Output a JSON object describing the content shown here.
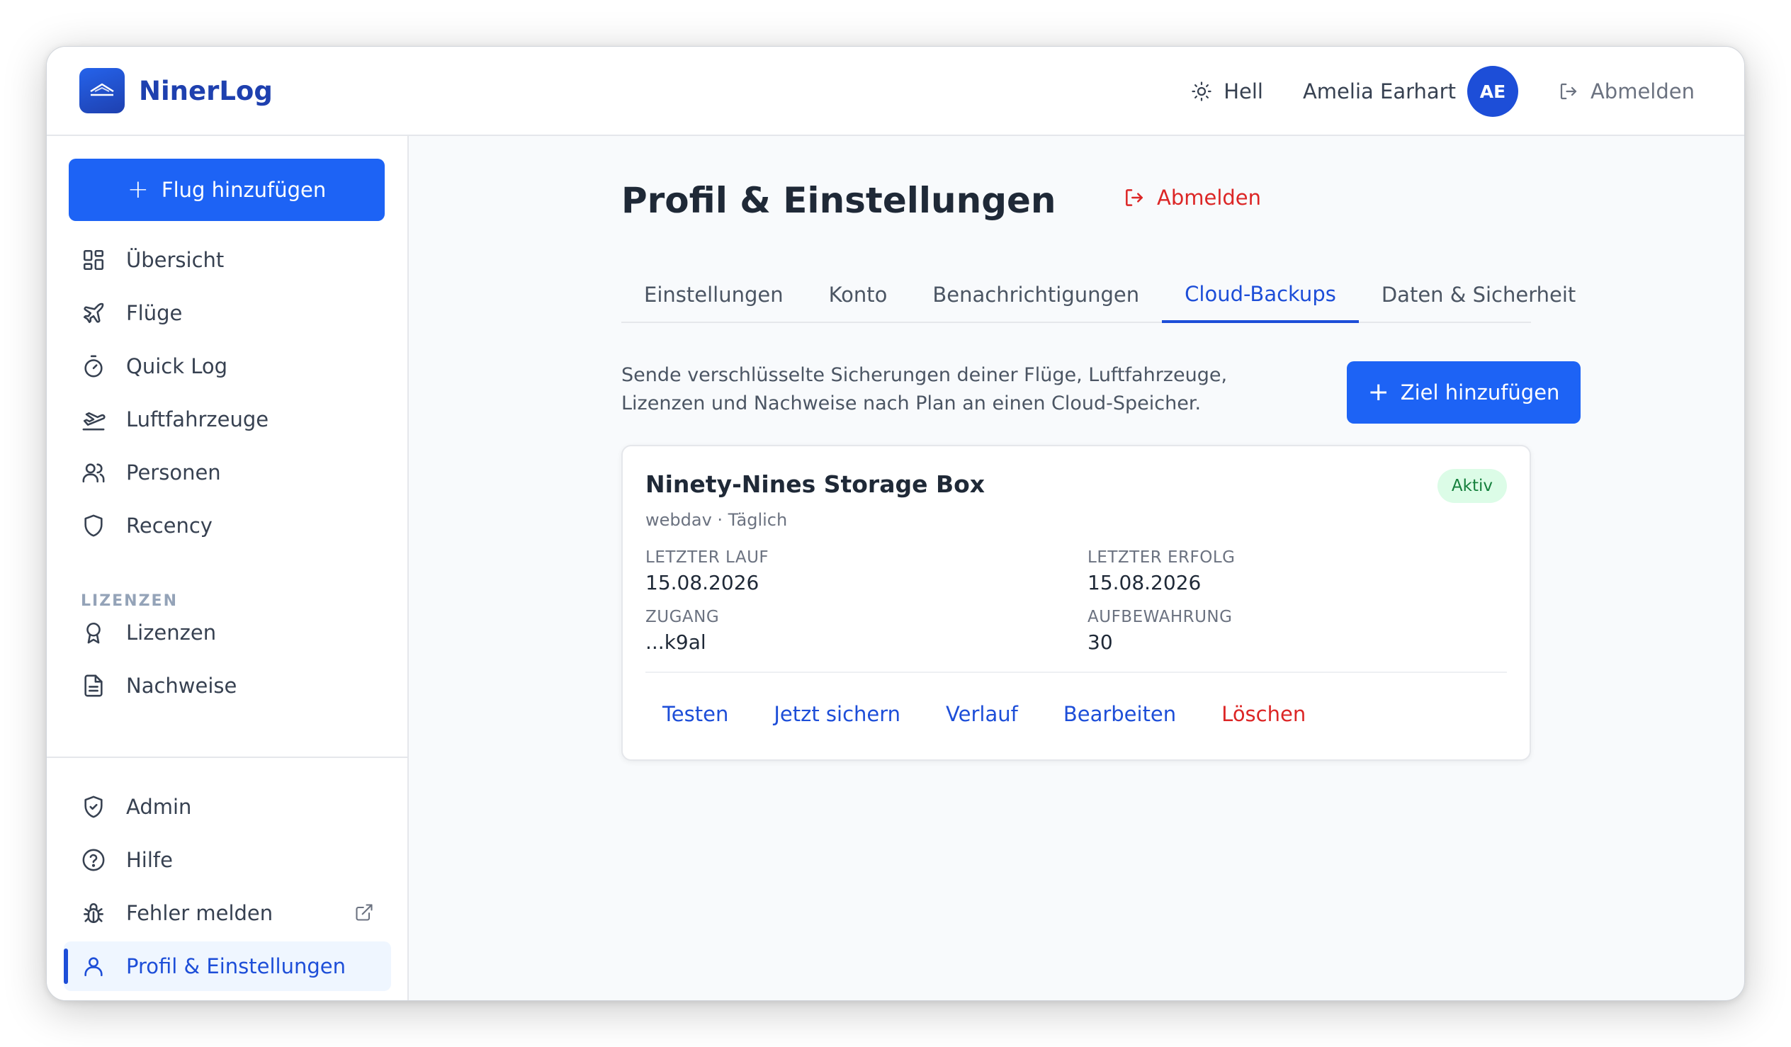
{
  "app": {
    "name": "NinerLog",
    "logo_icon": "plane-horizon-icon",
    "accent": "#1d63f5"
  },
  "topbar": {
    "theme_label": "Hell",
    "user_name": "Amelia Earhart",
    "avatar_initials": "AE",
    "logout_label": "Abmelden"
  },
  "sidebar": {
    "add_flight_label": "Flug hinzufügen",
    "items": [
      {
        "label": "Übersicht",
        "icon": "dashboard-icon"
      },
      {
        "label": "Flüge",
        "icon": "plane-icon"
      },
      {
        "label": "Quick Log",
        "icon": "stopwatch-icon"
      },
      {
        "label": "Luftfahrzeuge",
        "icon": "plane-takeoff-icon"
      },
      {
        "label": "Personen",
        "icon": "users-icon"
      },
      {
        "label": "Recency",
        "icon": "shield-icon"
      }
    ],
    "section_label": "LIZENZEN",
    "license_items": [
      {
        "label": "Lizenzen",
        "icon": "award-icon"
      },
      {
        "label": "Nachweise",
        "icon": "document-icon"
      }
    ],
    "bottom_items": [
      {
        "label": "Admin",
        "icon": "shield-check-icon"
      },
      {
        "label": "Hilfe",
        "icon": "help-circle-icon"
      },
      {
        "label": "Fehler melden",
        "icon": "bug-icon"
      },
      {
        "label": "Profil & Einstellungen",
        "icon": "user-icon",
        "active": true
      }
    ]
  },
  "main": {
    "title": "Profil & Einstellungen",
    "logout_label": "Abmelden",
    "tabs": [
      {
        "label": "Einstellungen"
      },
      {
        "label": "Konto"
      },
      {
        "label": "Benachrichtigungen"
      },
      {
        "label": "Cloud-Backups",
        "active": true
      },
      {
        "label": "Daten & Sicherheit"
      }
    ],
    "description": "Sende verschlüsselte Sicherungen deiner Flüge, Luftfahrzeuge, Lizenzen und Nachweise nach Plan an einen Cloud-Speicher.",
    "add_target_label": "Ziel hinzufügen",
    "card": {
      "title": "Ninety-Nines Storage Box",
      "subtitle": "webdav · Täglich",
      "status": "Aktiv",
      "last_run_label": "LETZTER LAUF",
      "last_run_value": "15.08.2026",
      "last_success_label": "LETZTER ERFOLG",
      "last_success_value": "15.08.2026",
      "access_label": "ZUGANG",
      "access_value": "...k9al",
      "retention_label": "AUFBEWAHRUNG",
      "retention_value": "30",
      "actions": {
        "test": "Testen",
        "backup_now": "Jetzt sichern",
        "history": "Verlauf",
        "edit": "Bearbeiten",
        "delete": "Löschen"
      }
    }
  }
}
